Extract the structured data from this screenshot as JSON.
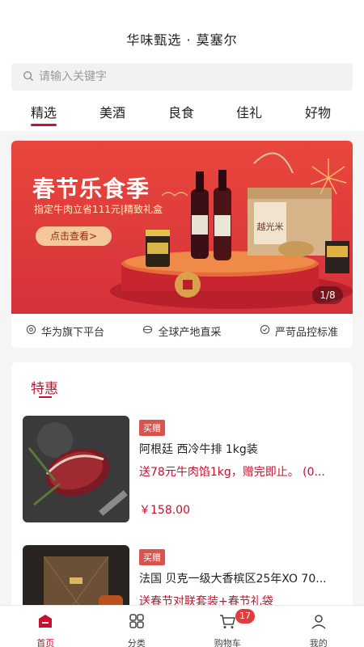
{
  "header": {
    "title": "华味甄选 · 莫塞尔"
  },
  "search": {
    "placeholder": "请输入关键字"
  },
  "tabs": [
    {
      "label": "精选",
      "active": true
    },
    {
      "label": "美酒",
      "active": false
    },
    {
      "label": "良食",
      "active": false
    },
    {
      "label": "佳礼",
      "active": false
    },
    {
      "label": "好物",
      "active": false
    }
  ],
  "banner": {
    "title": "春节乐食季",
    "subtitle": "指定牛肉立省111元|精致礼盒",
    "button": "点击查看>",
    "pager": "1/8",
    "colors": {
      "primary": "#d5313b",
      "button": "#f4c89a"
    }
  },
  "features": [
    {
      "label": "华为旗下平台",
      "icon": "shield-icon"
    },
    {
      "label": "全球产地直采",
      "icon": "globe-icon"
    },
    {
      "label": "严苛品控标准",
      "icon": "check-circle-icon"
    }
  ],
  "deals": {
    "title": "特惠",
    "products": [
      {
        "badge": "买赠",
        "name": "阿根廷 西冷牛排 1kg装",
        "promo": "送78元牛肉馅1kg，赠完即止。 (0...",
        "price": "￥158.00",
        "image": "steak-image"
      },
      {
        "badge": "买赠",
        "name": "法国 贝克一级大香槟区25年XO 70...",
        "promo": "送春节对联套装+春节礼袋",
        "price": "",
        "image": "cognac-gift-box-image"
      }
    ]
  },
  "nav": {
    "items": [
      {
        "label": "首页",
        "icon": "home-icon",
        "active": true
      },
      {
        "label": "分类",
        "icon": "grid-icon",
        "active": false
      },
      {
        "label": "购物车",
        "icon": "cart-icon",
        "active": false
      },
      {
        "label": "我的",
        "icon": "user-icon",
        "active": false
      }
    ],
    "cart_count": "17"
  },
  "colors": {
    "accent": "#c8102e"
  }
}
